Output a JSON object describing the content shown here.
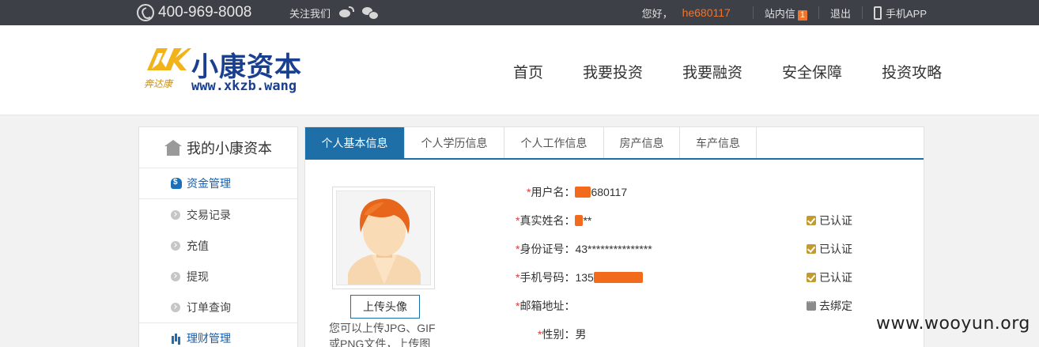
{
  "topbar": {
    "phone": "400-969-8008",
    "follow": "关注我们",
    "greeting": "您好，",
    "username": "he680117",
    "messages_label": "站内信",
    "messages_count": "1",
    "logout": "退出",
    "mobile_app": "手机APP"
  },
  "logo": {
    "name": "小康资本",
    "script": "奔达康",
    "url": "www.xkzb.wang"
  },
  "nav": [
    "首页",
    "我要投资",
    "我要融资",
    "安全保障",
    "投资攻略"
  ],
  "sidebar": {
    "title": "我的小康资本",
    "group1": "资金管理",
    "items": [
      "交易记录",
      "充值",
      "提现",
      "订单查询"
    ],
    "group2": "理财管理"
  },
  "tabs": [
    "个人基本信息",
    "个人学历信息",
    "个人工作信息",
    "房产信息",
    "车产信息"
  ],
  "profile": {
    "upload_button": "上传头像",
    "upload_hint": "您可以上传JPG、GIF或PNG文件，上传图",
    "fields": [
      {
        "label": "用户名：",
        "value": "680117",
        "masked": true
      },
      {
        "label": "真实姓名：",
        "value": "**",
        "masked": true,
        "status": "已认证",
        "status_type": "verified"
      },
      {
        "label": "身份证号：",
        "value": "43***************",
        "masked": false,
        "status": "已认证",
        "status_type": "verified"
      },
      {
        "label": "手机号码：",
        "value": "135",
        "masked": true,
        "status": "已认证",
        "status_type": "verified"
      },
      {
        "label": "邮箱地址：",
        "value": "",
        "masked": false,
        "status": "去绑定",
        "status_type": "unbound"
      },
      {
        "label": "性别：",
        "value": "男",
        "masked": false
      }
    ],
    "required_mark": "*"
  },
  "watermark": "www.wooyun.org",
  "colors": {
    "topbar_bg": "#3e4048",
    "accent_orange": "#f0742c",
    "brand_blue": "#1e6fa8",
    "verified_gold": "#c39a2e"
  }
}
